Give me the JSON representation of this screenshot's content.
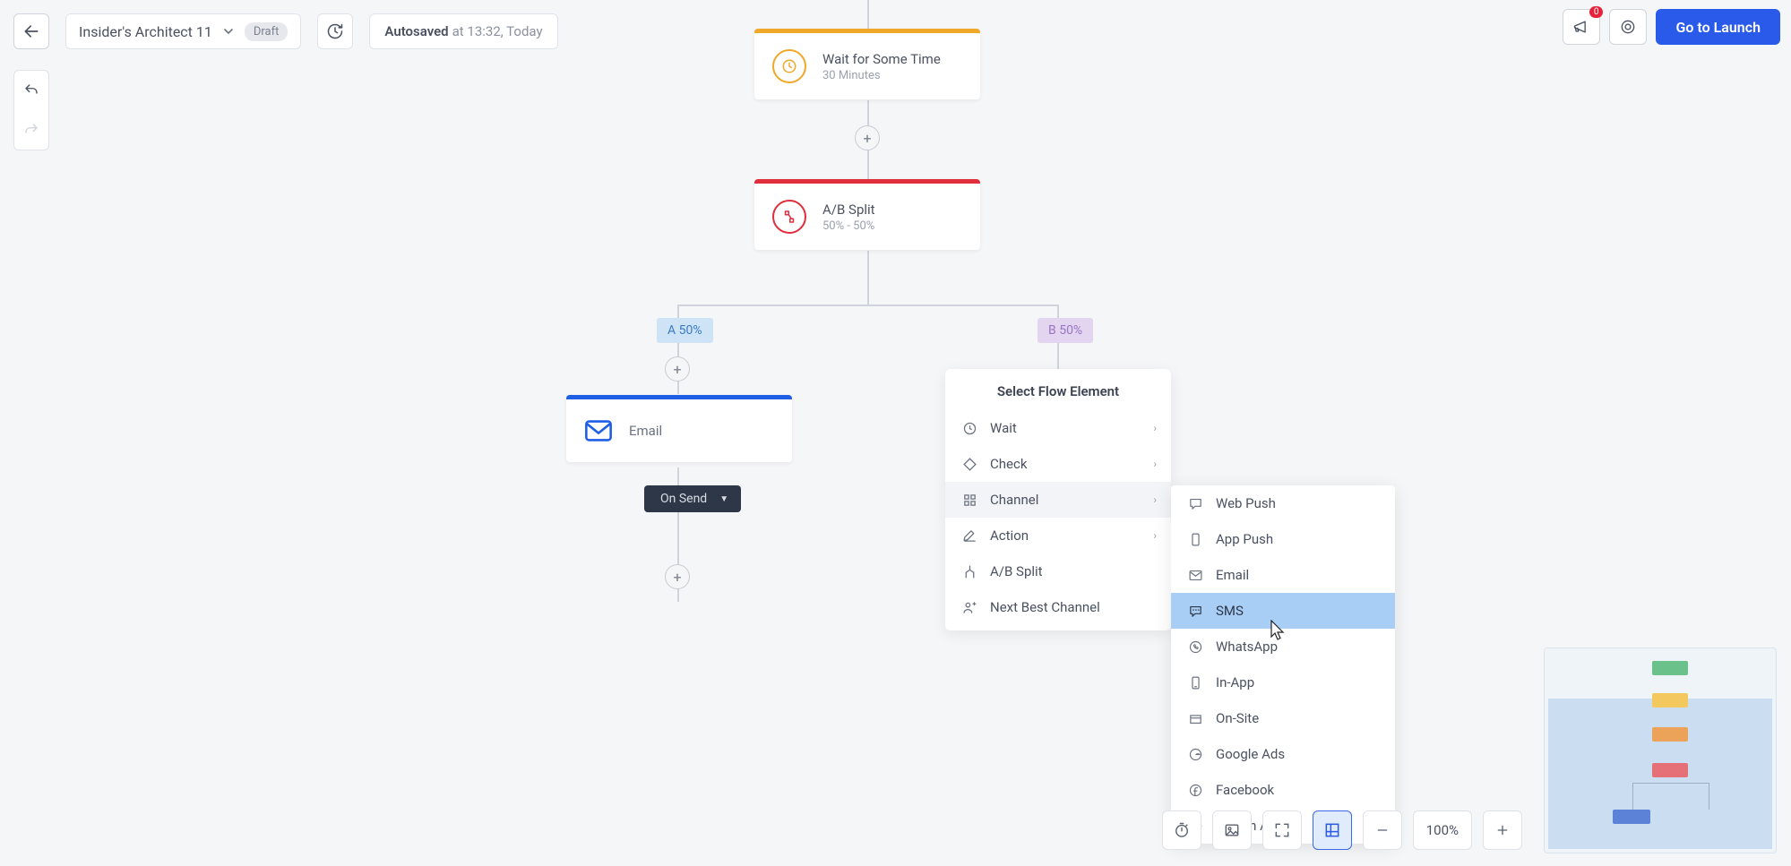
{
  "header": {
    "title": "Insider's Architect 11",
    "status_badge": "Draft",
    "autosave_prefix": "Autosaved",
    "autosave_time": "at 13:32, Today",
    "launch_button": "Go to Launch",
    "notification_count": "0"
  },
  "nodes": {
    "wait": {
      "title": "Wait for Some Time",
      "subtitle": "30 Minutes",
      "color": "#f0a829"
    },
    "split": {
      "title": "A/B Split",
      "subtitle": "50% - 50%",
      "color": "#e02e3d"
    },
    "email": {
      "title": "Email",
      "color": "#1f5fe6"
    },
    "branch_a": "A 50%",
    "branch_b": "B 50%",
    "on_send": "On Send"
  },
  "panel": {
    "title": "Select Flow Element",
    "items": [
      {
        "label": "Wait",
        "icon": "clock",
        "arrow": true
      },
      {
        "label": "Check",
        "icon": "diamond",
        "arrow": true
      },
      {
        "label": "Channel",
        "icon": "grid",
        "arrow": true,
        "active": true
      },
      {
        "label": "Action",
        "icon": "pencil",
        "arrow": true
      },
      {
        "label": "A/B Split",
        "icon": "split",
        "arrow": false
      },
      {
        "label": "Next Best Channel",
        "icon": "people",
        "arrow": false
      }
    ]
  },
  "submenu": {
    "items": [
      {
        "label": "Web Push",
        "icon": "chat"
      },
      {
        "label": "App Push",
        "icon": "phone"
      },
      {
        "label": "Email",
        "icon": "mail"
      },
      {
        "label": "SMS",
        "icon": "sms",
        "highlighted": true
      },
      {
        "label": "WhatsApp",
        "icon": "clock"
      },
      {
        "label": "In-App",
        "icon": "phone"
      },
      {
        "label": "On-Site",
        "icon": "box"
      },
      {
        "label": "Google Ads",
        "icon": "google"
      },
      {
        "label": "Facebook",
        "icon": "fbook"
      },
      {
        "label": "Call an API",
        "icon": "code"
      }
    ]
  },
  "zoom": "100%"
}
